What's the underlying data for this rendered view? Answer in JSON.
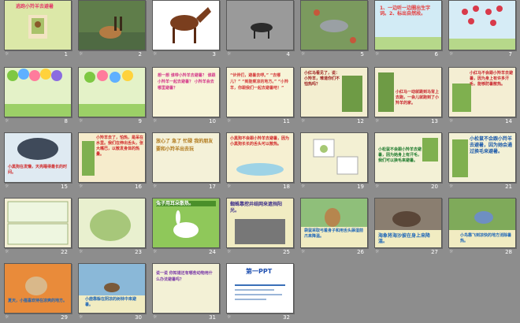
{
  "slides": [
    {
      "num": "1",
      "text": "逃跑小羚羊去避暑"
    },
    {
      "num": "2",
      "text": ""
    },
    {
      "num": "3",
      "text": ""
    },
    {
      "num": "4",
      "text": ""
    },
    {
      "num": "5",
      "text": ""
    },
    {
      "num": "6",
      "text": "1、一边听一边圈出生字词。2、标出自然段。"
    },
    {
      "num": "7",
      "text": ""
    },
    {
      "num": "8",
      "text": ""
    },
    {
      "num": "9",
      "text": ""
    },
    {
      "num": "10",
      "text": "想一想 谁带小羚羊去避暑？ 谁跟小羚羊一起去避暑？ 小羚羊会去哪里避暑？"
    },
    {
      "num": "11",
      "text": "“伙伴们，避暑去啰。” “去哪儿？” “到能乘凉的地方。” “小羚羊，你跟我们一起去避暑吧！”"
    },
    {
      "num": "12",
      "text": "小红马看见了，说：小羚羊，难道你们不怕热吗？"
    },
    {
      "num": "13",
      "text": "小红马一动就跳到马背上去跑，一会儿就跑到了小羚羊的家。"
    },
    {
      "num": "14",
      "text": "小红马不会跟小羚羊去避暑，因为身上有许多汗毛，能够防暑散热。"
    },
    {
      "num": "15",
      "text": "小黑狗在发懒，天亮睡得最长的时间。"
    },
    {
      "num": "16",
      "text": "小羚羊去了，怕热，是呆在水里。我们在伸出舌头，张大嘴巴，以散发身体的热量。"
    },
    {
      "num": "17",
      "text": "放心了 急了 忙碌 我的朋友 要和小羚羊出去玩"
    },
    {
      "num": "18",
      "text": "小黑狗不会跟小羚羊去避暑，因为小黑狗长长的舌头可以散热。"
    },
    {
      "num": "19",
      "text": ""
    },
    {
      "num": "20",
      "text": "小松鼠不会跟小羚羊去避暑，因为她身上有汗毛，我们可以换毛来避暑。"
    },
    {
      "num": "21",
      "text": "小松鼠不会跟小羚羊去避暑，因为她会通过换毛来避暑。"
    },
    {
      "num": "22",
      "text": ""
    },
    {
      "num": "23",
      "text": ""
    },
    {
      "num": "24",
      "text": "兔子用耳朵散热。"
    },
    {
      "num": "25",
      "text": "蜘蛛靠挖井结网来遮挡阳光。"
    },
    {
      "num": "26",
      "text": "袋鼠采取弓着身子和用舌头舔湿前爪来降温。"
    },
    {
      "num": "27",
      "text": "海象将海沙披在身上来降温。"
    },
    {
      "num": "28",
      "text": "小鸟靠飞到凉快的地方消除暑热。"
    },
    {
      "num": "29",
      "text": "夏天，小猫喜欢待在凉爽的地方。"
    },
    {
      "num": "30",
      "text": "小鹿靠躲在阴凉的树林中来避暑。"
    },
    {
      "num": "31",
      "text": "说一说 你知道还有哪些动物用什么办法避暑吗？"
    },
    {
      "num": "32",
      "text": "第一PPT"
    }
  ]
}
